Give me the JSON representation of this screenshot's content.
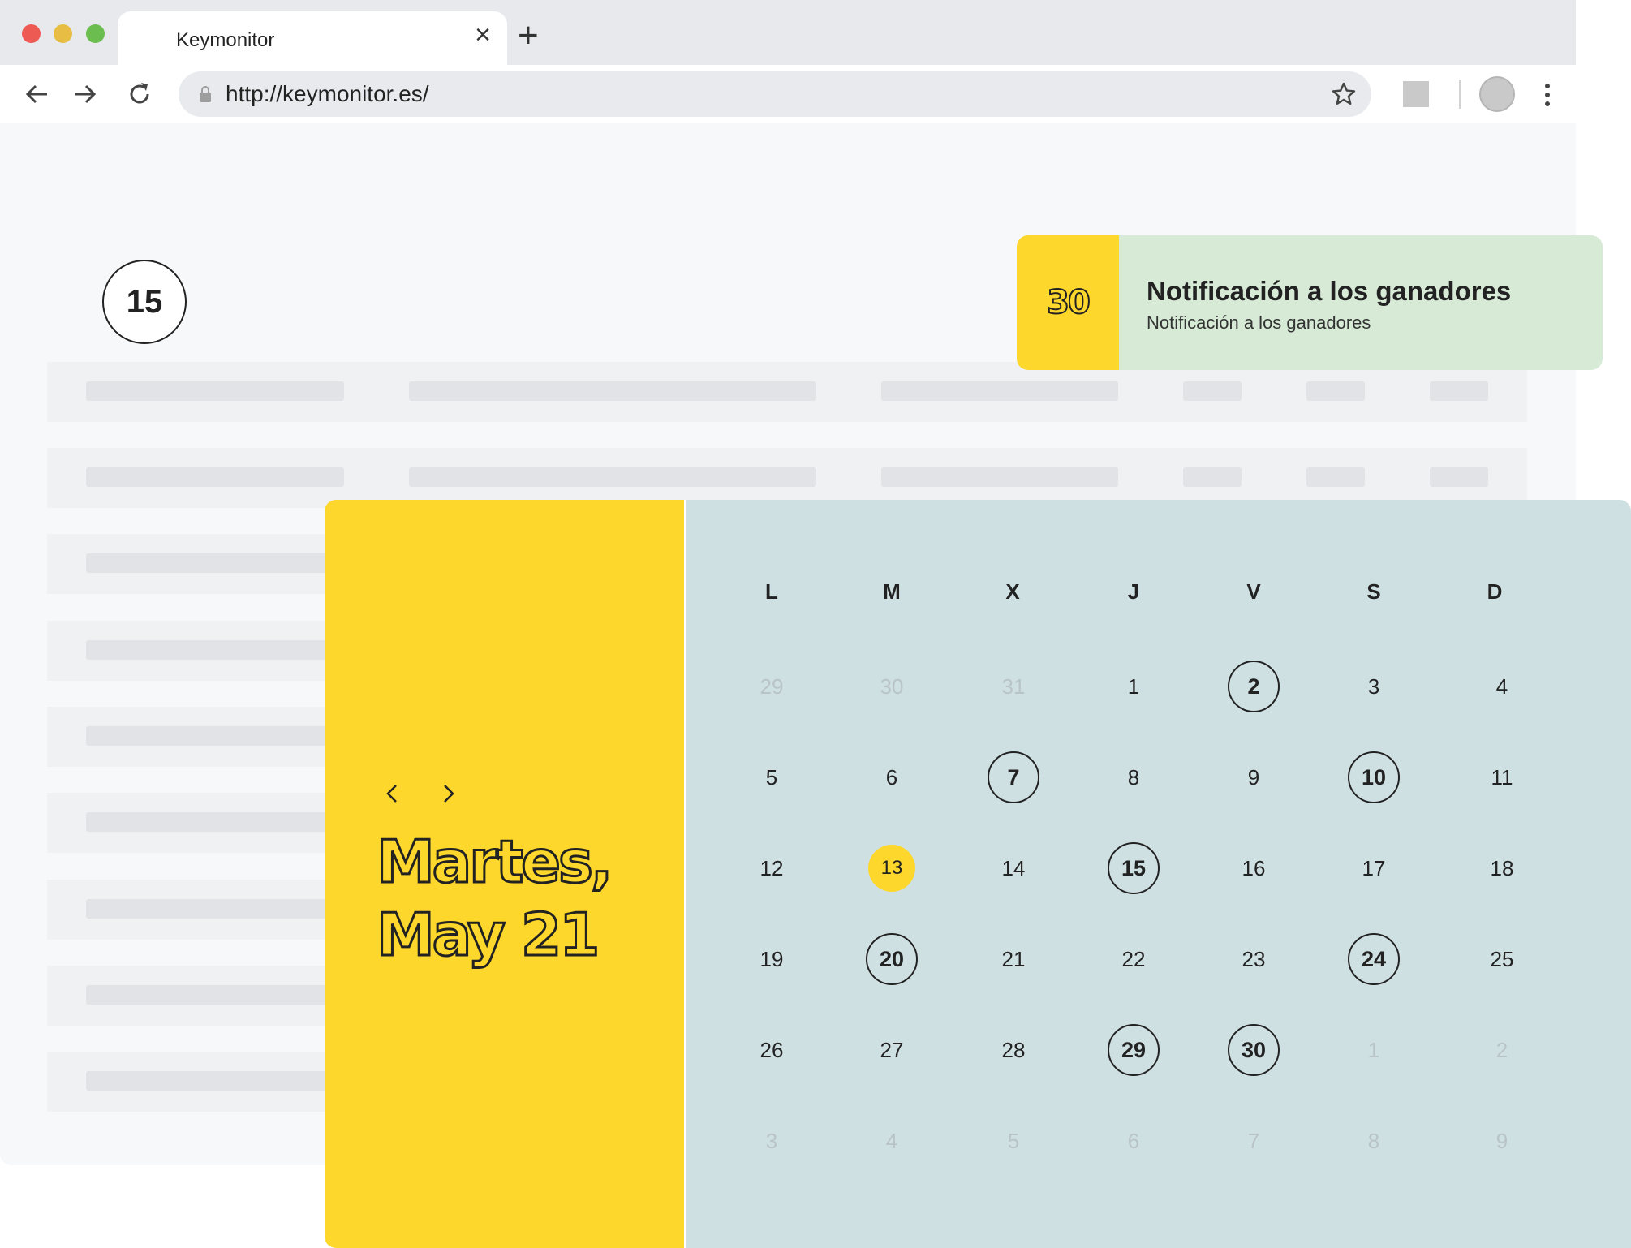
{
  "browser": {
    "tab_title": "Keymonitor",
    "url": "http://keymonitor.es/"
  },
  "page": {
    "badge_number": "15"
  },
  "notification": {
    "number": "30",
    "title": "Notificación a los ganadores",
    "subtitle": "Notificación a los ganadores"
  },
  "calendar": {
    "date_line1": "Martes,",
    "date_line2": "May 21",
    "weekdays": [
      "L",
      "M",
      "X",
      "J",
      "V",
      "S",
      "D"
    ],
    "weeks": [
      [
        {
          "d": "29",
          "s": "muted"
        },
        {
          "d": "30",
          "s": "muted"
        },
        {
          "d": "31",
          "s": "muted"
        },
        {
          "d": "1",
          "s": ""
        },
        {
          "d": "2",
          "s": "circled"
        },
        {
          "d": "3",
          "s": ""
        },
        {
          "d": "4",
          "s": ""
        }
      ],
      [
        {
          "d": "5",
          "s": ""
        },
        {
          "d": "6",
          "s": ""
        },
        {
          "d": "7",
          "s": "circled"
        },
        {
          "d": "8",
          "s": ""
        },
        {
          "d": "9",
          "s": ""
        },
        {
          "d": "10",
          "s": "circled"
        },
        {
          "d": "11",
          "s": ""
        }
      ],
      [
        {
          "d": "12",
          "s": ""
        },
        {
          "d": "13",
          "s": "today"
        },
        {
          "d": "14",
          "s": ""
        },
        {
          "d": "15",
          "s": "circled"
        },
        {
          "d": "16",
          "s": ""
        },
        {
          "d": "17",
          "s": ""
        },
        {
          "d": "18",
          "s": ""
        }
      ],
      [
        {
          "d": "19",
          "s": ""
        },
        {
          "d": "20",
          "s": "circled"
        },
        {
          "d": "21",
          "s": ""
        },
        {
          "d": "22",
          "s": ""
        },
        {
          "d": "23",
          "s": ""
        },
        {
          "d": "24",
          "s": "circled"
        },
        {
          "d": "25",
          "s": ""
        }
      ],
      [
        {
          "d": "26",
          "s": ""
        },
        {
          "d": "27",
          "s": ""
        },
        {
          "d": "28",
          "s": ""
        },
        {
          "d": "29",
          "s": "circled"
        },
        {
          "d": "30",
          "s": "circled"
        },
        {
          "d": "1",
          "s": "muted"
        },
        {
          "d": "2",
          "s": "muted"
        }
      ],
      [
        {
          "d": "3",
          "s": "muted"
        },
        {
          "d": "4",
          "s": "muted"
        },
        {
          "d": "5",
          "s": "muted"
        },
        {
          "d": "6",
          "s": "muted"
        },
        {
          "d": "7",
          "s": "muted"
        },
        {
          "d": "8",
          "s": "muted"
        },
        {
          "d": "9",
          "s": "muted"
        }
      ]
    ]
  },
  "colors": {
    "accent_yellow": "#fdd72b",
    "calendar_bg": "#cfe0e3",
    "notification_bg": "#d6ead6"
  }
}
